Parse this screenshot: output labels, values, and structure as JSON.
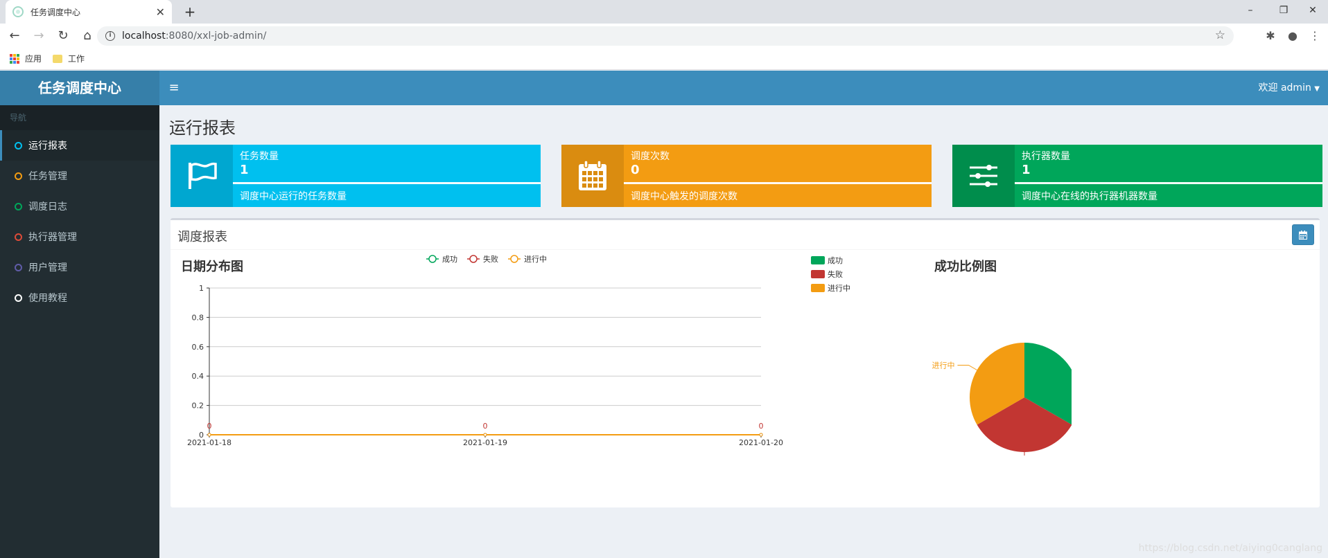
{
  "browser": {
    "tab_title": "任务调度中心",
    "url_host": "localhost",
    "url_path": ":8080/xxl-job-admin/",
    "bookmarks": [
      "应用",
      "工作"
    ]
  },
  "header": {
    "logo": "任务调度中心",
    "user": "欢迎 admin"
  },
  "sidebar": {
    "section": "导航",
    "items": [
      {
        "label": "运行报表",
        "color": "#00c0ef"
      },
      {
        "label": "任务管理",
        "color": "#f39c12"
      },
      {
        "label": "调度日志",
        "color": "#00a65a"
      },
      {
        "label": "执行器管理",
        "color": "#dd4b39"
      },
      {
        "label": "用户管理",
        "color": "#605ca8"
      },
      {
        "label": "使用教程",
        "color": "#ffffff"
      }
    ]
  },
  "page": {
    "title": "运行报表"
  },
  "infoboxes": [
    {
      "label": "任务数量",
      "value": "1",
      "desc": "调度中心运行的任务数量",
      "color": "#00c0ef",
      "icon": "flag-icon"
    },
    {
      "label": "调度次数",
      "value": "0",
      "desc": "调度中心触发的调度次数",
      "color": "#f39c12",
      "icon": "calendar-icon"
    },
    {
      "label": "执行器数量",
      "value": "1",
      "desc": "调度中心在线的执行器机器数量",
      "color": "#00a65a",
      "icon": "sliders-icon"
    }
  ],
  "report": {
    "title": "调度报表"
  },
  "chart_data": [
    {
      "type": "line",
      "title": "日期分布图",
      "categories": [
        "2021-01-18",
        "2021-01-19",
        "2021-01-20"
      ],
      "series": [
        {
          "name": "成功",
          "values": [
            0,
            0,
            0
          ],
          "color": "#00a65a"
        },
        {
          "name": "失败",
          "values": [
            0,
            0,
            0
          ],
          "color": "#c23632"
        },
        {
          "name": "进行中",
          "values": [
            0,
            0,
            0
          ],
          "color": "#f39c12"
        }
      ],
      "ylim": [
        0,
        1
      ],
      "yticks": [
        "0",
        "0.2",
        "0.4",
        "0.6",
        "0.8",
        "1"
      ],
      "data_labels": [
        "0",
        "0",
        "0"
      ],
      "legend": "top-center",
      "grid": true
    },
    {
      "type": "pie",
      "title": "成功比例图",
      "slices": [
        {
          "name": "成功",
          "value": 1,
          "color": "#00a65a"
        },
        {
          "name": "失败",
          "value": 1,
          "color": "#c23632"
        },
        {
          "name": "进行中",
          "value": 1,
          "color": "#f39c12"
        }
      ],
      "legend": "top-left"
    }
  ],
  "watermark": "https://blog.csdn.net/aiying0canglang"
}
